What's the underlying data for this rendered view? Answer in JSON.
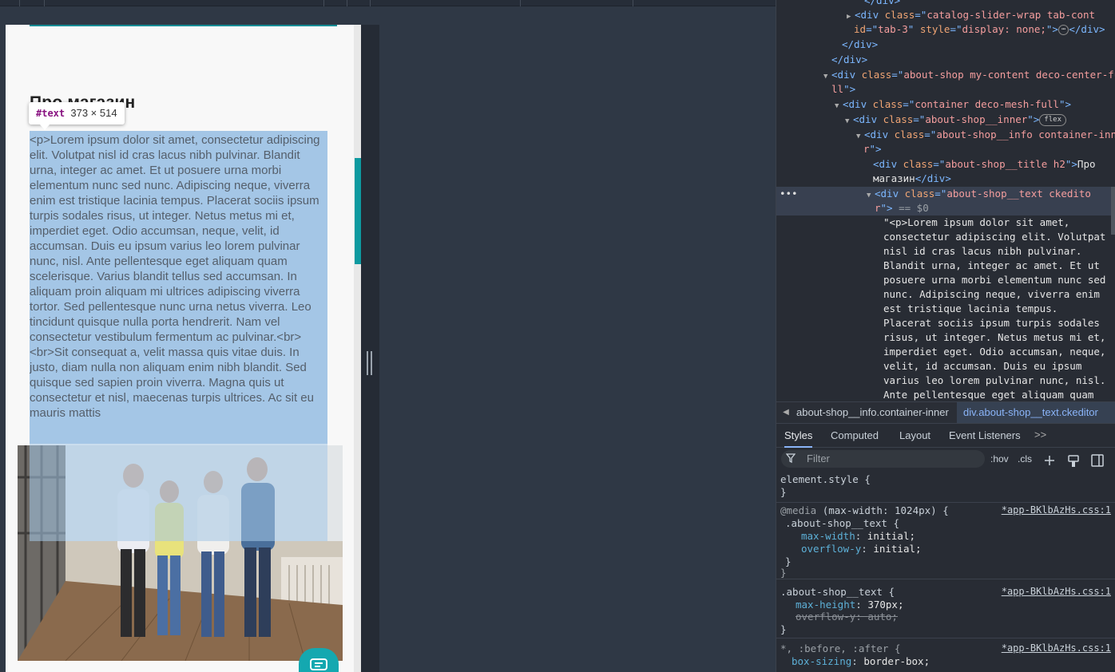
{
  "page": {
    "title": "Про магазин",
    "text_highlight_label": "#text",
    "text_highlight_size": "373 × 514",
    "paragraph": "<p>Lorem ipsum dolor sit amet, consectetur adipiscing elit. Volutpat nisl id cras lacus nibh pulvinar. Blandit urna, integer ac amet. Et ut posuere urna morbi elementum nunc sed nunc. Adipiscing neque, viverra enim est tristique lacinia tempus. Placerat sociis ipsum turpis sodales risus, ut integer. Netus metus mi et, imperdiet eget. Odio accumsan, neque, velit, id accumsan. Duis eu ipsum varius leo lorem pulvinar nunc, nisl. Ante pellentesque eget aliquam quam scelerisque. Varius blandit tellus sed accumsan. In aliquam proin aliquam mi ultrices adipiscing viverra tortor. Sed pellentesque nunc urna netus viverra. Leo tincidunt quisque nulla porta hendrerit. Nam vel consectetur vestibulum fermentum ac pulvinar.<br><br>Sit consequat a, velit massa quis vitae duis. In justo, diam nulla non aliquam enim nibh blandit. Sed quisque sed sapien proin viverra. Magna quis ut consectetur et nisl, maecenas turpis ultrices. Ac sit eu mauris mattis"
  },
  "elements_tree": {
    "l0_close": "</div>",
    "l1_tag": "div",
    "l1_class": "catalog-slider-wrap tab-cont",
    "l1b_id": "tab-3",
    "l1b_style": "display: none;",
    "l1b_more": "⋯",
    "l1b_close": "</div>",
    "l2_close": "</div>",
    "l3_close": "</div>",
    "l4_class_a": "about-shop my-content deco-center-fu",
    "l4_class_b": "ll",
    "l5_class": "container deco-mesh-full",
    "l6_class": "about-shop__inner",
    "l6_badge": "flex",
    "l7_class_a": "about-shop__info container-inne",
    "l7_class_b": "r",
    "l8_class": "about-shop__title h2",
    "l8_text_a": "Про",
    "l8_text_b": "магазин",
    "l9_class_a": "about-shop__text ckedito",
    "l9_class_b": "r",
    "l9_marker": "== $0",
    "text_node": "\"<p>Lorem ipsum dolor sit amet, consectetur adipiscing elit. Volutpat nisl id cras lacus nibh pulvinar. Blandit urna, integer ac amet. Et ut posuere urna morbi elementum nunc sed nunc. Adipiscing neque, viverra enim est tristique lacinia tempus. Placerat sociis ipsum turpis sodales risus, ut integer. Netus metus mi et, imperdiet eget. Odio accumsan, neque, velit, id accumsan. Duis eu ipsum varius leo lorem pulvinar nunc, nisl. Ante pellentesque eget aliquam quam"
  },
  "breadcrumb": {
    "item1": "about-shop__info.container-inner",
    "item2": "div.about-shop__text.ckeditor"
  },
  "tabs": [
    "Styles",
    "Computed",
    "Layout",
    "Event Listeners"
  ],
  "tabs_more": ">>",
  "filter": {
    "placeholder": "Filter",
    "hov": ":hov",
    "cls": ".cls"
  },
  "styles": {
    "r1_sel": "element.style {",
    "r1_close": "}",
    "r2_media_kw": "@media",
    "r2_media_q": "(max-width: 1024px) {",
    "r2_src": "*app-BKlbAzHs.css:1",
    "r2_sel": ".about-shop__text {",
    "r2_p1": "max-width",
    "r2_v1": "initial;",
    "r2_p2": "overflow-y",
    "r2_v2": "initial;",
    "r2_close": "}",
    "r2_close_media": "}",
    "r3_sel": ".about-shop__text {",
    "r3_src": "*app-BKlbAzHs.css:1",
    "r3_p1": "max-height",
    "r3_v1": "370px;",
    "r3_p2": "overflow-y",
    "r3_v2": "auto;",
    "r3_close": "}",
    "r4_sel": "*, :before, :after {",
    "r4_src": "*app-BKlbAzHs.css:1",
    "r4_p1": "box-sizing",
    "r4_v1": "border-box;"
  },
  "colors": {
    "accent": "#14a8b0",
    "highlight": "#a4c6e6",
    "devtools_bg": "#282c34"
  }
}
